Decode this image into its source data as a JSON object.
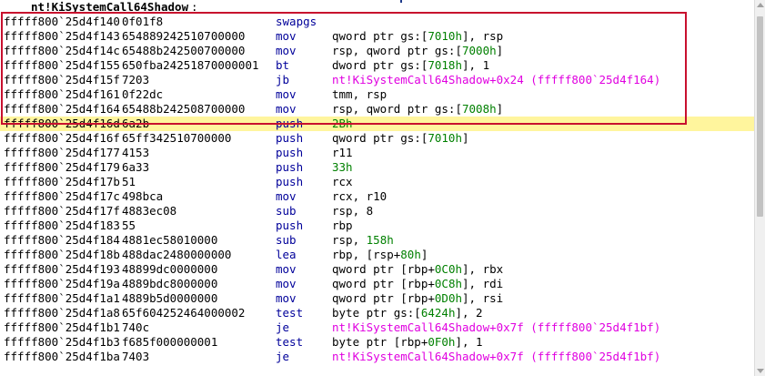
{
  "function_label": "nt!KiSystemCall64Shadow",
  "function_label_suffix": ":",
  "current_line_index": 7,
  "colors": {
    "mnemonic": "#00009a",
    "immediate": "#008000",
    "symbol": "#e000e0",
    "selection_border": "#c8102e",
    "current_line": "#fff59d"
  },
  "lines": [
    {
      "addr": "fffff800`25d4f140",
      "bytes": "0f01f8",
      "mnem": "swapgs",
      "ops": []
    },
    {
      "addr": "fffff800`25d4f143",
      "bytes": "654889242510700000",
      "mnem": "mov",
      "ops": [
        {
          "t": "qword ptr gs:[",
          "k": "n"
        },
        {
          "t": "7010h",
          "k": "i"
        },
        {
          "t": "], rsp",
          "k": "n"
        }
      ]
    },
    {
      "addr": "fffff800`25d4f14c",
      "bytes": "65488b242500700000",
      "mnem": "mov",
      "ops": [
        {
          "t": "rsp, qword ptr gs:[",
          "k": "n"
        },
        {
          "t": "7000h",
          "k": "i"
        },
        {
          "t": "]",
          "k": "n"
        }
      ]
    },
    {
      "addr": "fffff800`25d4f155",
      "bytes": "650fba24251870000001",
      "mnem": "bt",
      "ops": [
        {
          "t": "dword ptr gs:[",
          "k": "n"
        },
        {
          "t": "7018h",
          "k": "i"
        },
        {
          "t": "], 1",
          "k": "n"
        }
      ]
    },
    {
      "addr": "fffff800`25d4f15f",
      "bytes": "7203",
      "mnem": "jb",
      "ops": [
        {
          "t": "nt!KiSystemCall64Shadow+0x24 (fffff800`25d4f164)",
          "k": "s"
        }
      ]
    },
    {
      "addr": "fffff800`25d4f161",
      "bytes": "0f22dc",
      "mnem": "mov",
      "ops": [
        {
          "t": "tmm, rsp",
          "k": "n"
        }
      ]
    },
    {
      "addr": "fffff800`25d4f164",
      "bytes": "65488b242508700000",
      "mnem": "mov",
      "ops": [
        {
          "t": "rsp, qword ptr gs:[",
          "k": "n"
        },
        {
          "t": "7008h",
          "k": "i"
        },
        {
          "t": "]",
          "k": "n"
        }
      ]
    },
    {
      "addr": "fffff800`25d4f16d",
      "bytes": "6a2b",
      "mnem": "push",
      "ops": [
        {
          "t": "2Bh",
          "k": "i"
        }
      ]
    },
    {
      "addr": "fffff800`25d4f16f",
      "bytes": "65ff342510700000",
      "mnem": "push",
      "ops": [
        {
          "t": "qword ptr gs:[",
          "k": "n"
        },
        {
          "t": "7010h",
          "k": "i"
        },
        {
          "t": "]",
          "k": "n"
        }
      ]
    },
    {
      "addr": "fffff800`25d4f177",
      "bytes": "4153",
      "mnem": "push",
      "ops": [
        {
          "t": "r11",
          "k": "n"
        }
      ]
    },
    {
      "addr": "fffff800`25d4f179",
      "bytes": "6a33",
      "mnem": "push",
      "ops": [
        {
          "t": "33h",
          "k": "i"
        }
      ]
    },
    {
      "addr": "fffff800`25d4f17b",
      "bytes": "51",
      "mnem": "push",
      "ops": [
        {
          "t": "rcx",
          "k": "n"
        }
      ]
    },
    {
      "addr": "fffff800`25d4f17c",
      "bytes": "498bca",
      "mnem": "mov",
      "ops": [
        {
          "t": "rcx, r10",
          "k": "n"
        }
      ]
    },
    {
      "addr": "fffff800`25d4f17f",
      "bytes": "4883ec08",
      "mnem": "sub",
      "ops": [
        {
          "t": "rsp, 8",
          "k": "n"
        }
      ]
    },
    {
      "addr": "fffff800`25d4f183",
      "bytes": "55",
      "mnem": "push",
      "ops": [
        {
          "t": "rbp",
          "k": "n"
        }
      ]
    },
    {
      "addr": "fffff800`25d4f184",
      "bytes": "4881ec58010000",
      "mnem": "sub",
      "ops": [
        {
          "t": "rsp, ",
          "k": "n"
        },
        {
          "t": "158h",
          "k": "i"
        }
      ]
    },
    {
      "addr": "fffff800`25d4f18b",
      "bytes": "488dac2480000000",
      "mnem": "lea",
      "ops": [
        {
          "t": "rbp, [rsp+",
          "k": "n"
        },
        {
          "t": "80h",
          "k": "i"
        },
        {
          "t": "]",
          "k": "n"
        }
      ]
    },
    {
      "addr": "fffff800`25d4f193",
      "bytes": "48899dc0000000",
      "mnem": "mov",
      "ops": [
        {
          "t": "qword ptr [rbp+",
          "k": "n"
        },
        {
          "t": "0C0h",
          "k": "i"
        },
        {
          "t": "], rbx",
          "k": "n"
        }
      ]
    },
    {
      "addr": "fffff800`25d4f19a",
      "bytes": "4889bdc8000000",
      "mnem": "mov",
      "ops": [
        {
          "t": "qword ptr [rbp+",
          "k": "n"
        },
        {
          "t": "0C8h",
          "k": "i"
        },
        {
          "t": "], rdi",
          "k": "n"
        }
      ]
    },
    {
      "addr": "fffff800`25d4f1a1",
      "bytes": "4889b5d0000000",
      "mnem": "mov",
      "ops": [
        {
          "t": "qword ptr [rbp+",
          "k": "n"
        },
        {
          "t": "0D0h",
          "k": "i"
        },
        {
          "t": "], rsi",
          "k": "n"
        }
      ]
    },
    {
      "addr": "fffff800`25d4f1a8",
      "bytes": "65f604252464000002",
      "mnem": "test",
      "ops": [
        {
          "t": "byte ptr gs:[",
          "k": "n"
        },
        {
          "t": "6424h",
          "k": "i"
        },
        {
          "t": "], 2",
          "k": "n"
        }
      ]
    },
    {
      "addr": "fffff800`25d4f1b1",
      "bytes": "740c",
      "mnem": "je",
      "ops": [
        {
          "t": "nt!KiSystemCall64Shadow+0x7f (fffff800`25d4f1bf)",
          "k": "s"
        }
      ]
    },
    {
      "addr": "fffff800`25d4f1b3",
      "bytes": "f685f000000001",
      "mnem": "test",
      "ops": [
        {
          "t": "byte ptr [rbp+",
          "k": "n"
        },
        {
          "t": "0F0h",
          "k": "i"
        },
        {
          "t": "], 1",
          "k": "n"
        }
      ]
    },
    {
      "addr": "fffff800`25d4f1ba",
      "bytes": "7403",
      "mnem": "je",
      "ops": [
        {
          "t": "nt!KiSystemCall64Shadow+0x7f (fffff800`25d4f1bf)",
          "k": "s"
        }
      ]
    }
  ]
}
